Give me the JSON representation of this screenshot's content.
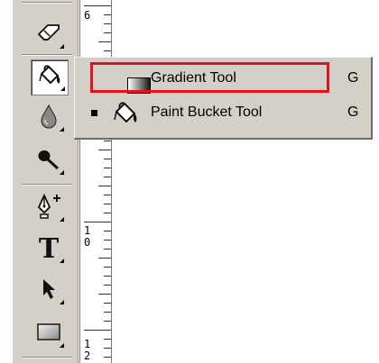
{
  "ruler": {
    "labels": [
      {
        "text": "6"
      },
      {
        "text": "1"
      },
      {
        "text": "0"
      },
      {
        "text": "1"
      },
      {
        "text": "2"
      }
    ]
  },
  "tools": [
    {
      "name": "eraser-tool",
      "icon": "eraser-icon"
    },
    {
      "name": "paint-bucket-tool",
      "icon": "paint-bucket-icon",
      "selected": true
    },
    {
      "name": "blur-tool",
      "icon": "water-drop-icon"
    },
    {
      "name": "dodge-tool",
      "icon": "dodge-icon"
    },
    {
      "name": "pen-tool",
      "icon": "pen-plus-icon"
    },
    {
      "name": "type-tool",
      "icon": "type-icon",
      "glyph": "T"
    },
    {
      "name": "path-selection-tool",
      "icon": "arrow-icon"
    },
    {
      "name": "rectangle-tool",
      "icon": "rectangle-icon"
    }
  ],
  "flyout": {
    "items": [
      {
        "label": "Gradient Tool",
        "shortcut": "G",
        "icon": "gradient-icon",
        "active": false,
        "highlighted": true,
        "highlight_color": "#e0141e"
      },
      {
        "label": "Paint Bucket Tool",
        "shortcut": "G",
        "icon": "paint-bucket-icon",
        "active": true
      }
    ]
  }
}
